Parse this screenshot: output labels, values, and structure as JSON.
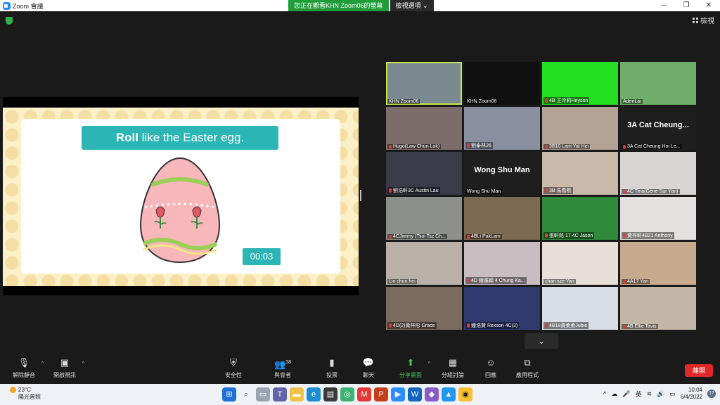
{
  "window": {
    "title": "Zoom 會議",
    "controls": [
      "–",
      "❐",
      "✕"
    ]
  },
  "share_banner": {
    "message": "您正在觀看KHN Zoom06的螢幕",
    "view_options": "檢視選項 ⌄"
  },
  "view_button": "檢視",
  "slide": {
    "title_bold": "Roll",
    "title_rest": " like the Easter egg.",
    "timer": "00:03"
  },
  "tiles": [
    {
      "name": "KHN Zoom06",
      "muted": false,
      "bg": "#7a8a90",
      "active": true
    },
    {
      "name": "KHN Zoom06",
      "muted": false,
      "bg": "#111111"
    },
    {
      "name": "4B 王冷莉Heyson",
      "muted": true,
      "bg": "#22e022"
    },
    {
      "name": "AdenLai",
      "muted": false,
      "bg": "#6fae6a"
    },
    {
      "name": "Hugo(Law Chun Lok)",
      "muted": true,
      "bg": "#7c6d6a"
    },
    {
      "name": "劉泰林26",
      "muted": true,
      "bg": "#8a8fa0"
    },
    {
      "name": "3B10 Lam Yat Hei",
      "muted": true,
      "bg": "#b3a394"
    },
    {
      "name": "3A Cat Cheung Hoi Le...",
      "muted": true,
      "bg": "#1e1e1e",
      "big": "3A Cat Cheung..."
    },
    {
      "name": "劉浩軒3C Austin Lau",
      "muted": true,
      "bg": "#3a3a48"
    },
    {
      "name": "Wong Shu Man",
      "muted": false,
      "bg": "#1e1e1e",
      "big": "Wong Shu Man"
    },
    {
      "name": "3B 馬喬熙",
      "muted": true,
      "bg": "#c9b9a9"
    },
    {
      "name": "4C Tina(Gene Sur Yan)",
      "muted": true,
      "bg": "#d9d4d4"
    },
    {
      "name": "4CJimmy (Tsoi Tsz Ch...",
      "muted": true,
      "bg": "#8d8f8a"
    },
    {
      "name": "4BLi PakLam",
      "muted": true,
      "bg": "#7d6a52"
    },
    {
      "name": "張軒銘 17 4C Jason",
      "muted": true,
      "bg": "#2f8a3a"
    },
    {
      "name": "黃梓軒4B21 Anthony",
      "muted": true,
      "bg": "#e4e2e0"
    },
    {
      "name": "Lin chun hei",
      "muted": false,
      "bg": "#b9b1a7"
    },
    {
      "name": "4D 鍾蓬穎 4 Chung Ka...",
      "muted": true,
      "bg": "#c8bdc1"
    },
    {
      "name": "chan sze Yan",
      "muted": false,
      "bg": "#e6e0d8"
    },
    {
      "name": "4A17 Yan",
      "muted": true,
      "bg": "#c7a98e"
    },
    {
      "name": "4D(2)黃梓彤 Grace",
      "muted": true,
      "bg": "#7a6b5d"
    },
    {
      "name": "鍾浩賢 Rexson 4C(3)",
      "muted": true,
      "bg": "#2e3a6e"
    },
    {
      "name": "4B18黃柔柔Jubie",
      "muted": true,
      "bg": "#d8dde3"
    },
    {
      "name": "4B Ellie Tavis",
      "muted": true,
      "bg": "#c2b6a6"
    }
  ],
  "scroll_icon": "⌄",
  "toolbar": {
    "unmute": "解除靜音",
    "start_video": "開啟視訊",
    "security": "安全性",
    "participants": "與會者",
    "participants_count": "38",
    "polls": "投票",
    "chat": "聊天",
    "share_screen": "分享畫面",
    "breakout": "分組討論",
    "reactions": "回應",
    "apps": "應用程式",
    "leave": "離開"
  },
  "taskbar": {
    "temp": "23°C",
    "weather": "陽光普照",
    "ime": "英",
    "time": "10:04",
    "date": "6/4/2022",
    "notifications": "17"
  }
}
